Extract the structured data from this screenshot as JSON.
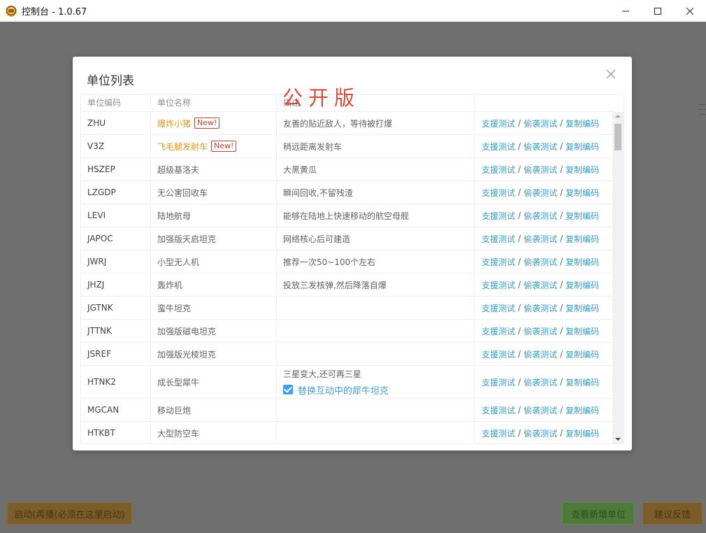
{
  "window": {
    "title": "控制台 - 1.0.67"
  },
  "modal": {
    "title": "单位列表",
    "watermark": "公开版",
    "columns": [
      "单位编码",
      "单位名称",
      "描述",
      ""
    ],
    "actions": {
      "support": "支援测试",
      "raid": "偷袭测试",
      "copy": "复制编码",
      "separator": "/"
    },
    "rows": [
      {
        "code": "ZHU",
        "name": "爆炸小猪",
        "badge": "New!",
        "desc": "友善的贴近敌人，等待被打爆"
      },
      {
        "code": "V3Z",
        "name": "飞毛腿发射车",
        "badge": "New!",
        "desc": "稍远距离发射车"
      },
      {
        "code": "HSZEP",
        "name": "超级基洛夫",
        "badge": "",
        "desc": "大黑黄瓜"
      },
      {
        "code": "LZGDP",
        "name": "无公害回收车",
        "badge": "",
        "desc": "瞬间回收,不留残渣"
      },
      {
        "code": "LEVI",
        "name": "陆地航母",
        "badge": "",
        "desc": "能够在陆地上快速移动的航空母舰"
      },
      {
        "code": "JAPOC",
        "name": "加强版天启坦克",
        "badge": "",
        "desc": "网络核心后可建造"
      },
      {
        "code": "JWRJ",
        "name": "小型无人机",
        "badge": "",
        "desc": "推荐一次50~100个左右"
      },
      {
        "code": "JHZJ",
        "name": "轰炸机",
        "badge": "",
        "desc": "投放三发核弹,然后降落自爆"
      },
      {
        "code": "JGTNK",
        "name": "蛮牛坦克",
        "badge": "",
        "desc": ""
      },
      {
        "code": "JTTNK",
        "name": "加强版磁电坦克",
        "badge": "",
        "desc": ""
      },
      {
        "code": "JSREF",
        "name": "加强版光棱坦克",
        "badge": "",
        "desc": ""
      },
      {
        "code": "HTNK2",
        "name": "成长型犀牛",
        "badge": "",
        "desc": "三星变大,还可再三星",
        "checkbox_label": "替换互动中的犀牛坦克",
        "checked": true
      },
      {
        "code": "MGCAN",
        "name": "移动巨炮",
        "badge": "",
        "desc": ""
      },
      {
        "code": "HTKBT",
        "name": "大型防空车",
        "badge": "",
        "desc": ""
      }
    ]
  },
  "bottom": {
    "start_label": "启动(再播(必须在这里启动)",
    "view_label": "查看新增单位",
    "feedback_label": "建议反馈"
  },
  "colors": {
    "accent_link": "#3a9ec0",
    "badge_red": "#b74632",
    "special_name": "#d39a28",
    "watermark": "#d23a2a",
    "checkbox": "#409eff"
  }
}
